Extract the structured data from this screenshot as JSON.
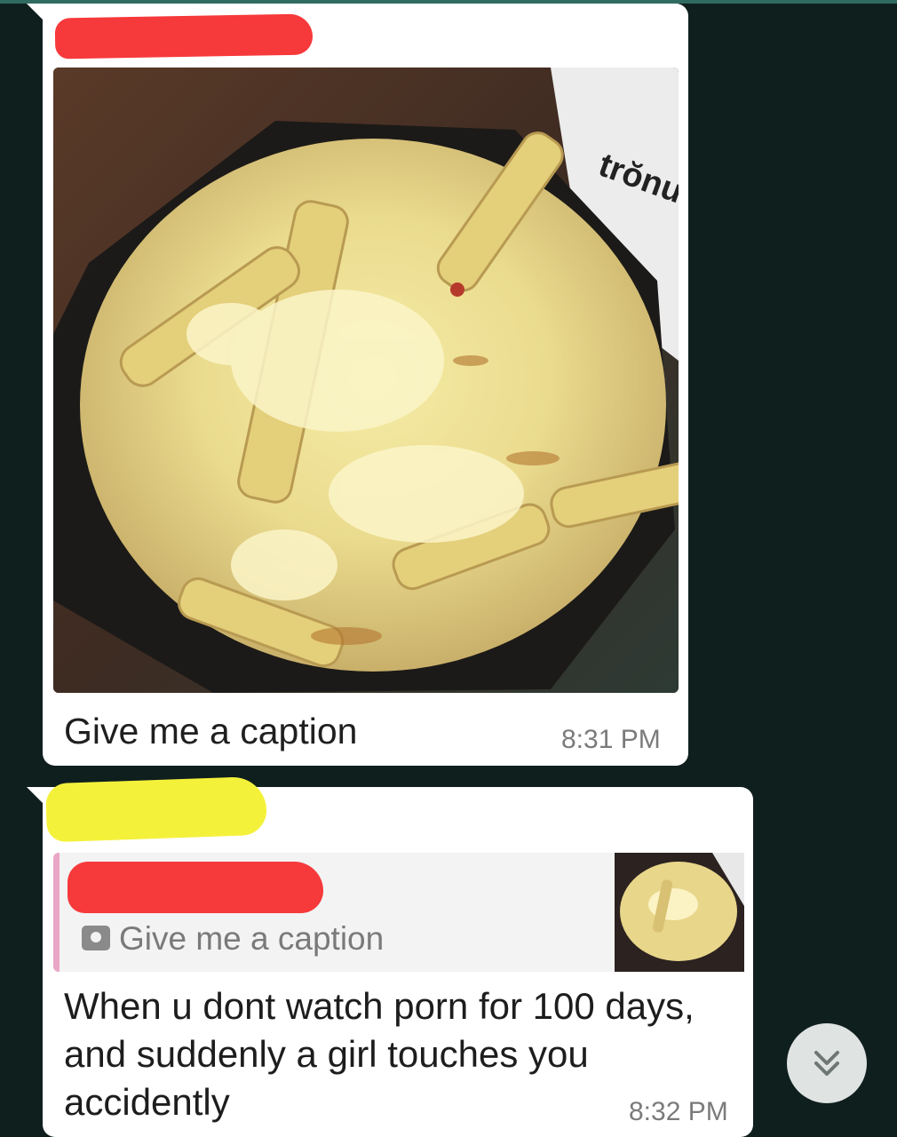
{
  "messages": [
    {
      "type": "image",
      "caption": "Give me a caption",
      "time": "8:31 PM",
      "image": {
        "description_icon": "cheese-fries-photo"
      }
    },
    {
      "type": "reply",
      "quoted": {
        "icon": "camera-icon",
        "text": "Give me a caption"
      },
      "text": "When u dont watch porn for 100 days, and suddenly a girl touches you accidently",
      "time": "8:32 PM"
    }
  ],
  "scroll_button": {
    "icon": "double-chevron-down-icon"
  },
  "colors": {
    "background": "#0f1f1e",
    "bubble": "#ffffff",
    "redact_red": "#f6393b",
    "redact_yellow": "#f4f13b",
    "quote_bar": "#e9a6c6",
    "timestamp": "#7b7b7b"
  }
}
